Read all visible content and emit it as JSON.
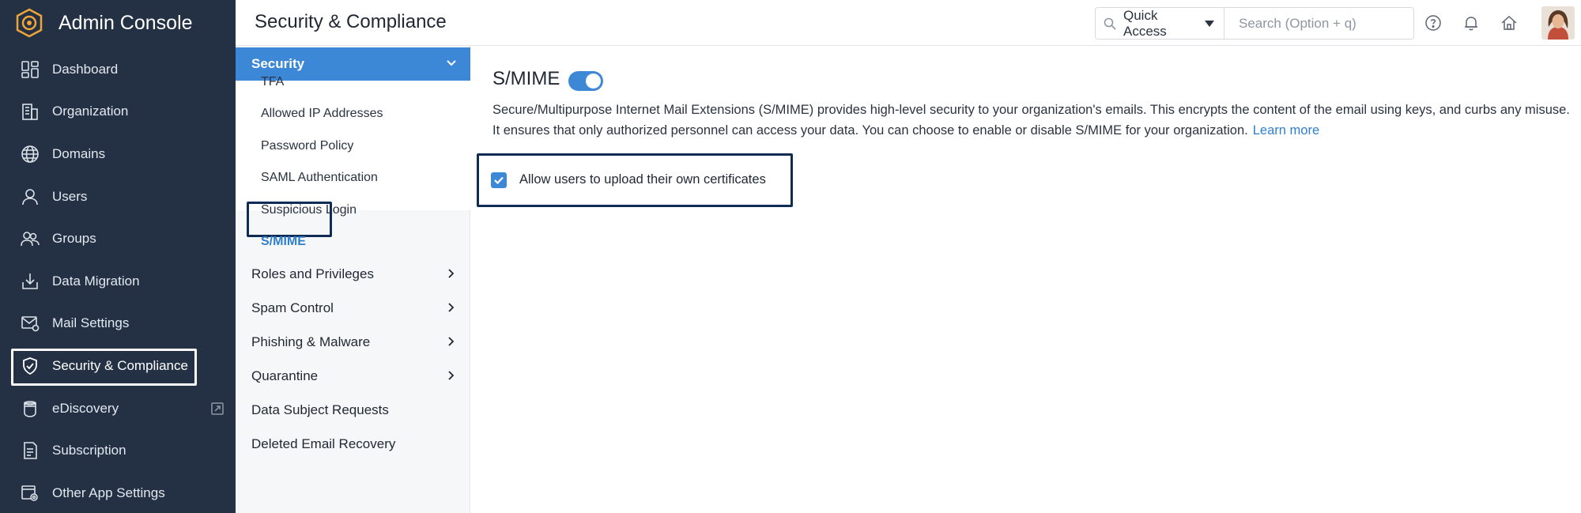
{
  "app": {
    "title": "Admin Console"
  },
  "sidebar": {
    "items": [
      {
        "label": "Dashboard",
        "icon": "dashboard-icon"
      },
      {
        "label": "Organization",
        "icon": "organization-icon"
      },
      {
        "label": "Domains",
        "icon": "globe-icon"
      },
      {
        "label": "Users",
        "icon": "user-icon"
      },
      {
        "label": "Groups",
        "icon": "groups-icon"
      },
      {
        "label": "Data Migration",
        "icon": "data-migration-icon"
      },
      {
        "label": "Mail Settings",
        "icon": "mail-settings-icon"
      },
      {
        "label": "Security & Compliance",
        "icon": "shield-icon",
        "active": true
      },
      {
        "label": "eDiscovery",
        "icon": "ediscovery-icon",
        "external": true
      },
      {
        "label": "Subscription",
        "icon": "subscription-icon"
      },
      {
        "label": "Other App Settings",
        "icon": "app-settings-icon"
      }
    ]
  },
  "header": {
    "title": "Security & Compliance",
    "quick_access": "Quick Access",
    "search_placeholder": "Search (Option + q)",
    "icons": [
      "help-icon",
      "bell-icon",
      "home-icon"
    ]
  },
  "submenu": {
    "section": "Security",
    "items": [
      "TFA",
      "Allowed IP Addresses",
      "Password Policy",
      "SAML Authentication",
      "Suspicious Login",
      "S/MIME"
    ],
    "active_item": "S/MIME",
    "groups": [
      {
        "label": "Roles and Privileges",
        "has_children": true
      },
      {
        "label": "Spam Control",
        "has_children": true
      },
      {
        "label": "Phishing & Malware",
        "has_children": true
      },
      {
        "label": "Quarantine",
        "has_children": true
      },
      {
        "label": "Data Subject Requests",
        "has_children": false
      },
      {
        "label": "Deleted Email Recovery",
        "has_children": false
      }
    ]
  },
  "main": {
    "title": "S/MIME",
    "toggle_on": true,
    "description": "Secure/Multipurpose Internet Mail Extensions (S/MIME) provides high-level security to your organization's emails. This encrypts the content of the email using keys, and curbs any misuse. It ensures that only authorized personnel can access your data. You can choose to enable or disable S/MIME for your organization.",
    "learn_more": "Learn more",
    "checkbox_label": "Allow users to upload their own certificates",
    "checkbox_checked": true
  },
  "colors": {
    "sidebar_bg": "#243144",
    "accent": "#3d88d6",
    "highlight_border": "#0e2c54",
    "link": "#2f7fcf"
  }
}
